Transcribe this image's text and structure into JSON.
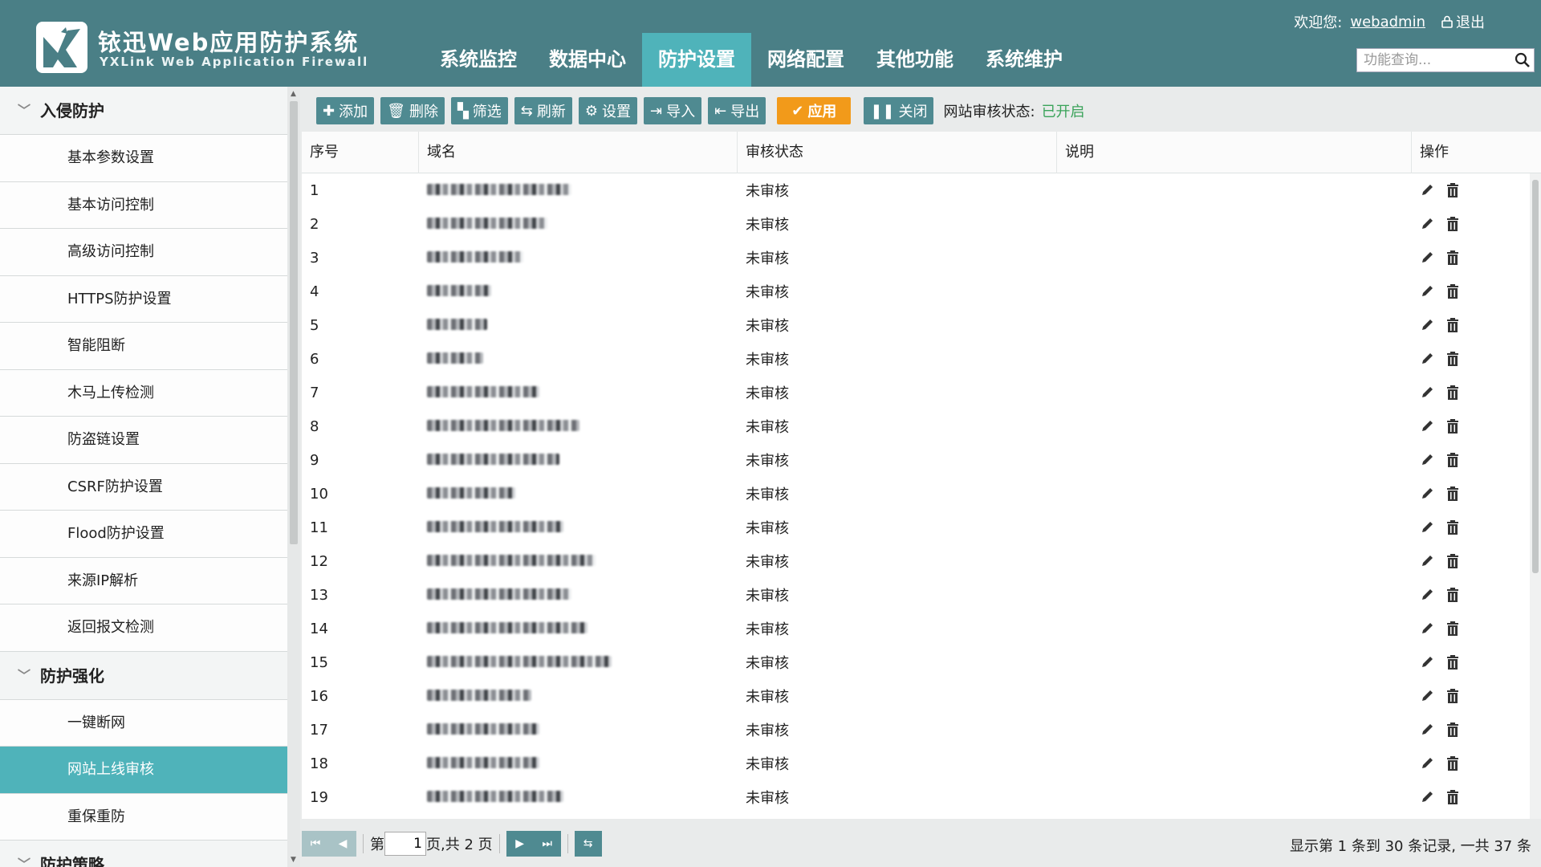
{
  "header": {
    "title": "铱迅Web应用防护系统",
    "subtitle": "YXLink Web Application Firewall",
    "welcome_label": "欢迎您:",
    "username": "webadmin",
    "logout_label": "退出",
    "search_placeholder": "功能查询..."
  },
  "nav": [
    "系统监控",
    "数据中心",
    "防护设置",
    "网络配置",
    "其他功能",
    "系统维护"
  ],
  "sidebar": {
    "group1": "入侵防护",
    "group1_items": [
      "基本参数设置",
      "基本访问控制",
      "高级访问控制",
      "HTTPS防护设置",
      "智能阻断",
      "木马上传检测",
      "防盗链设置",
      "CSRF防护设置",
      "Flood防护设置",
      "来源IP解析",
      "返回报文检测"
    ],
    "group2": "防护强化",
    "group2_items": [
      "一键断网",
      "网站上线审核",
      "重保重防"
    ],
    "group3": "防护策略"
  },
  "toolbar": {
    "add": "添加",
    "delete": "删除",
    "filter": "筛选",
    "refresh": "刷新",
    "settings": "设置",
    "import": "导入",
    "export": "导出",
    "apply": "应用",
    "close": "关闭",
    "status_label": "网站审核状态:",
    "status_value": "已开启"
  },
  "table": {
    "headers": [
      "序号",
      "域名",
      "审核状态",
      "说明",
      "操作"
    ],
    "rows": [
      {
        "no": "1",
        "status": "未审核"
      },
      {
        "no": "2",
        "status": "未审核"
      },
      {
        "no": "3",
        "status": "未审核"
      },
      {
        "no": "4",
        "status": "未审核"
      },
      {
        "no": "5",
        "status": "未审核"
      },
      {
        "no": "6",
        "status": "未审核"
      },
      {
        "no": "7",
        "status": "未审核"
      },
      {
        "no": "8",
        "status": "未审核"
      },
      {
        "no": "9",
        "status": "未审核"
      },
      {
        "no": "10",
        "status": "未审核"
      },
      {
        "no": "11",
        "status": "未审核"
      },
      {
        "no": "12",
        "status": "未审核"
      },
      {
        "no": "13",
        "status": "未审核"
      },
      {
        "no": "14",
        "status": "未审核"
      },
      {
        "no": "15",
        "status": "未审核"
      },
      {
        "no": "16",
        "status": "未审核"
      },
      {
        "no": "17",
        "status": "未审核"
      },
      {
        "no": "18",
        "status": "未审核"
      },
      {
        "no": "19",
        "status": "未审核"
      }
    ]
  },
  "pager": {
    "page_prefix": "第",
    "current_page": "1",
    "page_suffix": "页,共 2 页",
    "summary": "显示第 1 条到 30 条记录, 一共 37 条"
  }
}
